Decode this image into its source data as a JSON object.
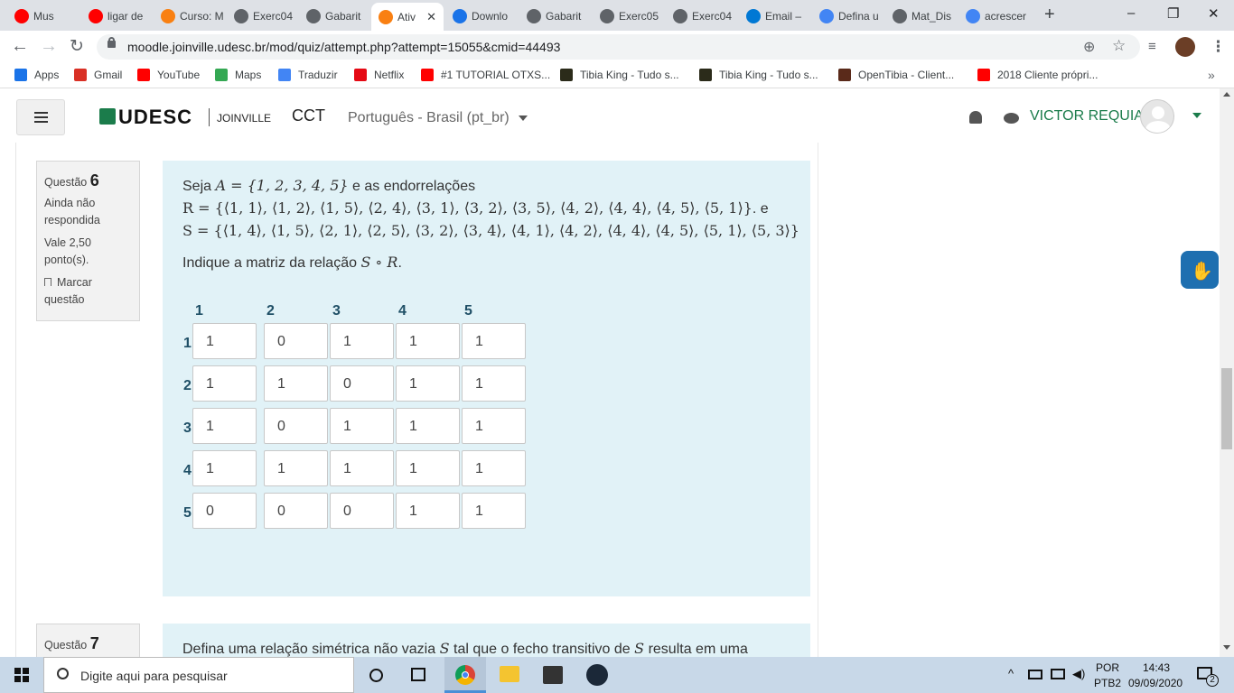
{
  "tabs": [
    {
      "label": "Mus",
      "icon": "youtube-icon",
      "color": "#ff0000"
    },
    {
      "label": "ligar de",
      "icon": "youtube-icon",
      "color": "#ff0000"
    },
    {
      "label": "Curso: M",
      "icon": "moodle-icon",
      "color": "#f98012"
    },
    {
      "label": "Exerc04",
      "icon": "globe-icon",
      "color": "#5f6368"
    },
    {
      "label": "Gabarit",
      "icon": "globe-icon",
      "color": "#5f6368"
    },
    {
      "label": "Ativ",
      "icon": "moodle-icon",
      "color": "#f98012"
    },
    {
      "label": "Downlo",
      "icon": "download-icon",
      "color": "#1a73e8"
    },
    {
      "label": "Gabarit",
      "icon": "globe-icon",
      "color": "#5f6368"
    },
    {
      "label": "Exerc05",
      "icon": "globe-icon",
      "color": "#5f6368"
    },
    {
      "label": "Exerc04",
      "icon": "globe-icon",
      "color": "#5f6368"
    },
    {
      "label": "Email –",
      "icon": "outlook-icon",
      "color": "#0078d4"
    },
    {
      "label": "Defina u",
      "icon": "google-icon",
      "color": "#4285f4"
    },
    {
      "label": "Mat_Dis",
      "icon": "globe-icon",
      "color": "#5f6368"
    },
    {
      "label": "acrescer",
      "icon": "google-icon",
      "color": "#4285f4"
    }
  ],
  "url": "moodle.joinville.udesc.br/mod/quiz/attempt.php?attempt=15055&cmid=44493",
  "bookmarks": [
    {
      "label": "Apps",
      "icon": "apps-icon",
      "color": "#1a73e8"
    },
    {
      "label": "Gmail",
      "icon": "gmail-icon",
      "color": "#d93025"
    },
    {
      "label": "YouTube",
      "icon": "youtube-icon",
      "color": "#ff0000"
    },
    {
      "label": "Maps",
      "icon": "maps-icon",
      "color": "#34a853"
    },
    {
      "label": "Traduzir",
      "icon": "translate-icon",
      "color": "#4285f4"
    },
    {
      "label": "Netflix",
      "icon": "netflix-icon",
      "color": "#e50914"
    },
    {
      "label": "#1 TUTORIAL OTXS...",
      "icon": "youtube-icon",
      "color": "#ff0000"
    },
    {
      "label": "Tibia King - Tudo s...",
      "icon": "tibia-icon",
      "color": "#2b2b1a"
    },
    {
      "label": "Tibia King - Tudo s...",
      "icon": "tibia-icon",
      "color": "#2b2b1a"
    },
    {
      "label": "OpenTibia - Client...",
      "icon": "opentibia-icon",
      "color": "#5a2a1a"
    },
    {
      "label": "2018 Cliente própri...",
      "icon": "youtube-icon",
      "color": "#ff0000"
    }
  ],
  "header": {
    "logo": "UDESC",
    "logo_sub": "JOINVILLE",
    "course": "CCT",
    "language": "Português - Brasil (pt_br)",
    "user": "VICTOR REQUIA"
  },
  "q6": {
    "label": "Questão",
    "number": "6",
    "status": "Ainda não respondida",
    "grade": "Vale 2,50 ponto(s).",
    "flag": "Marcar questão",
    "text_prefix": "Seja",
    "text_mid": "e as endorrelações",
    "set_A": "A = {1, 2, 3, 4, 5}",
    "rel_R": "R = {⟨1, 1⟩, ⟨1, 2⟩, ⟨1, 5⟩, ⟨2, 4⟩, ⟨3, 1⟩, ⟨3, 2⟩, ⟨3, 5⟩, ⟨4, 2⟩, ⟨4, 4⟩, ⟨4, 5⟩, ⟨5, 1⟩}",
    "rel_R_suffix": ". e",
    "rel_S": "S = {⟨1, 4⟩, ⟨1, 5⟩, ⟨2, 1⟩, ⟨2, 5⟩, ⟨3, 2⟩, ⟨3, 4⟩, ⟨4, 1⟩, ⟨4, 2⟩, ⟨4, 4⟩, ⟨4, 5⟩, ⟨5, 1⟩, ⟨5, 3⟩}",
    "instruction_prefix": "Indique a matriz da relação",
    "instruction_math": "S ∘ R",
    "instruction_suffix": ".",
    "col_headers": [
      "1",
      "2",
      "3",
      "4",
      "5"
    ],
    "row_headers": [
      "1",
      "2",
      "3",
      "4",
      "5"
    ],
    "matrix": [
      [
        "1",
        "0",
        "1",
        "1",
        "1"
      ],
      [
        "1",
        "1",
        "0",
        "1",
        "1"
      ],
      [
        "1",
        "0",
        "1",
        "1",
        "1"
      ],
      [
        "1",
        "1",
        "1",
        "1",
        "1"
      ],
      [
        "0",
        "0",
        "0",
        "1",
        "1"
      ]
    ]
  },
  "q7": {
    "label": "Questão",
    "number": "7",
    "text_prefix": "Defina uma relação simétrica não vazia",
    "math": "S",
    "text_mid": "tal que o fecho transitivo de",
    "math2": "S",
    "text_suffix": "resulta em uma"
  },
  "taskbar": {
    "search_placeholder": "Digite aqui para pesquisar",
    "lang": "POR",
    "layout": "PTB2",
    "time": "14:43",
    "date": "09/09/2020",
    "notifications": "2"
  },
  "colors": {
    "question_bg": "#e1f2f7",
    "user_green": "#1b7c4b",
    "matrix_header": "#1f4f66"
  }
}
